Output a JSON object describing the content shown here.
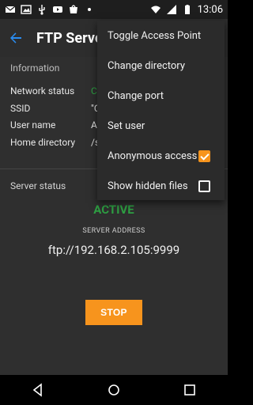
{
  "statusbar": {
    "time": "13:06",
    "left_icons": [
      "mail-icon",
      "image-icon",
      "usb-icon",
      "youtube-icon",
      "shopping-icon",
      "more-dot-icon"
    ],
    "right_icons": [
      "wifi-icon",
      "signal-icon",
      "battery-icon"
    ]
  },
  "appbar": {
    "title": "FTP Server"
  },
  "info": {
    "section_title": "Information",
    "rows": [
      {
        "label": "Network status",
        "value": "C"
      },
      {
        "label": "SSID",
        "value": "\"C"
      },
      {
        "label": "User name",
        "value": "A"
      },
      {
        "label": "Home directory",
        "value": "/s"
      }
    ]
  },
  "server": {
    "section_title": "Server status",
    "status": "ACTIVE",
    "address_label": "SERVER ADDRESS",
    "address": "ftp://192.168.2.105:9999",
    "stop_label": "STOP"
  },
  "menu": {
    "items": [
      {
        "label": "Toggle Access Point"
      },
      {
        "label": "Change directory"
      },
      {
        "label": "Change port"
      },
      {
        "label": "Set user"
      },
      {
        "label": "Anonymous access",
        "checked": true
      },
      {
        "label": "Show hidden files",
        "checked": false
      }
    ]
  },
  "navbar": {
    "icons": [
      "back-icon",
      "home-icon",
      "recents-icon"
    ]
  },
  "colors": {
    "accent": "#f7941d",
    "active_green": "#2ea043",
    "appbar": "#2d2d2d",
    "content": "#2f2f2f"
  }
}
